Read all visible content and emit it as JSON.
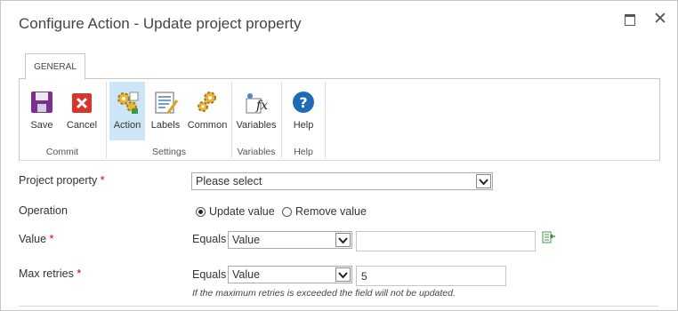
{
  "dialog": {
    "title": "Configure Action - Update project property",
    "maximize_icon": "maximize-icon",
    "close_glyph": "✕"
  },
  "ribbon": {
    "tab": "GENERAL",
    "groups": [
      {
        "label": "Commit",
        "buttons": [
          {
            "label": "Save",
            "icon": "save-icon"
          },
          {
            "label": "Cancel",
            "icon": "cancel-icon"
          }
        ]
      },
      {
        "label": "Settings",
        "buttons": [
          {
            "label": "Action",
            "icon": "action-gears-icon",
            "active": true
          },
          {
            "label": "Labels",
            "icon": "labels-icon"
          },
          {
            "label": "Common",
            "icon": "common-gears-icon"
          }
        ]
      },
      {
        "label": "Variables",
        "buttons": [
          {
            "label": "Variables",
            "icon": "variables-fx-icon"
          }
        ]
      },
      {
        "label": "Help",
        "buttons": [
          {
            "label": "Help",
            "icon": "help-icon"
          }
        ]
      }
    ]
  },
  "form": {
    "required_marker": "*",
    "project_property": {
      "label": "Project property",
      "value": "Please select"
    },
    "operation": {
      "label": "Operation",
      "options": [
        {
          "label": "Update value",
          "selected": true
        },
        {
          "label": "Remove value",
          "selected": false
        }
      ]
    },
    "value": {
      "label": "Value",
      "equals": "Equals",
      "type": "Value",
      "text": "",
      "lookup_icon": "insert-reference-icon"
    },
    "max_retries": {
      "label": "Max retries",
      "equals": "Equals",
      "type": "Value",
      "text": "5",
      "hint": "If the maximum retries is exceeded the field will not be updated."
    }
  },
  "colors": {
    "active_tab_bg": "#cde6f7",
    "required": "#cc0000",
    "help_blue": "#1e6bb8"
  }
}
